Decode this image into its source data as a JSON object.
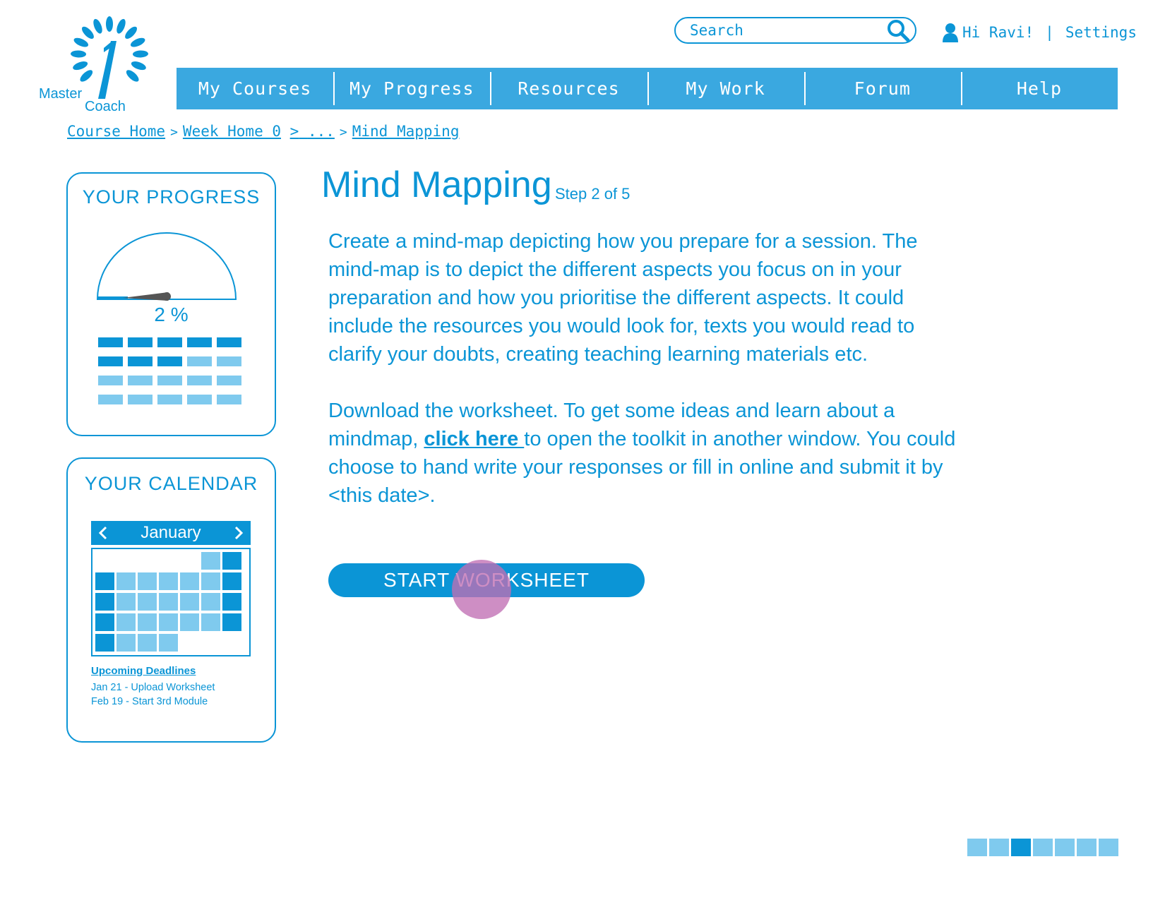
{
  "logo": {
    "line1": "Master",
    "line2": "Coach",
    "digit": "1"
  },
  "search": {
    "placeholder": "Search"
  },
  "user": {
    "greeting": "Hi Ravi!",
    "separator": "|",
    "settings": "Settings"
  },
  "nav": {
    "items": [
      "My Courses",
      "My Progress",
      "Resources",
      "My Work",
      "Forum",
      "Help"
    ]
  },
  "breadcrumb": {
    "items": [
      "Course Home",
      "Week Home 0",
      "...",
      "Mind Mapping"
    ],
    "separator": ">"
  },
  "progress": {
    "title": "YOUR PROGRESS",
    "percent_label": "2 %",
    "percent_value": 2,
    "grid_total": 20,
    "grid_completed": 8
  },
  "calendar": {
    "title": "YOUR CALENDAR",
    "month": "January",
    "deadlines_title": "Upcoming Deadlines",
    "deadlines": [
      "Jan 21 - Upload Worksheet",
      "Feb 19 - Start 3rd Module"
    ]
  },
  "main": {
    "title": "Mind Mapping",
    "step": "Step 2 of 5",
    "paragraph1": "Create a mind-map depicting how you prepare for a session. The mind-map is to depict the different aspects you focus on in your preparation and how you prioritise the different aspects.  It could include the resources you would look for, texts you would read to clarify your doubts, creating teaching learning materials etc.",
    "paragraph2_before": "Download the worksheet.  To get some ideas and learn about a mindmap, ",
    "paragraph2_link": "click here ",
    "paragraph2_after": "to open the toolkit in another window. You could choose to hand write your responses or fill in online and submit it by <this date>.",
    "button": "START WORKSHEET"
  },
  "pager": {
    "total": 7,
    "active": 3
  },
  "colors": {
    "primary": "#0b95d6",
    "nav": "#3aa8e0",
    "light": "#7fcaee"
  }
}
